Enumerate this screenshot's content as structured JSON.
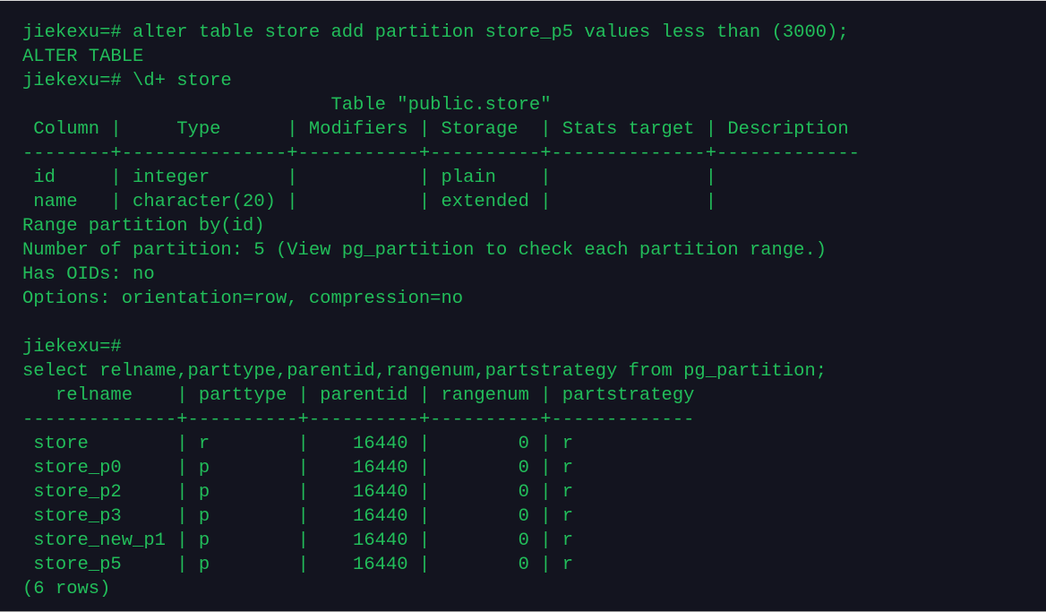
{
  "terminal": {
    "lines": [
      {
        "indent": 25,
        "text": "jiekexu=# alter table store add partition store_p5 values less than (3000);"
      },
      {
        "indent": 25,
        "text": "ALTER TABLE"
      },
      {
        "indent": 25,
        "text": "jiekexu=# \\d+ store"
      },
      {
        "indent": 25,
        "text": "                            Table \"public.store\""
      },
      {
        "indent": 25,
        "text": " Column |     Type      | Modifiers | Storage  | Stats target | Description"
      },
      {
        "indent": 25,
        "text": "--------+---------------+-----------+----------+--------------+-------------"
      },
      {
        "indent": 25,
        "text": " id     | integer       |           | plain    |              |"
      },
      {
        "indent": 25,
        "text": " name   | character(20) |           | extended |              |"
      },
      {
        "indent": 25,
        "text": "Range partition by(id)"
      },
      {
        "indent": 25,
        "text": "Number of partition: 5 (View pg_partition to check each partition range.)"
      },
      {
        "indent": 25,
        "text": "Has OIDs: no"
      },
      {
        "indent": 25,
        "text": "Options: orientation=row, compression=no"
      },
      {
        "indent": 25,
        "text": ""
      },
      {
        "indent": 25,
        "text": "jiekexu=#"
      },
      {
        "indent": 25,
        "text": "select relname,parttype,parentid,rangenum,partstrategy from pg_partition;"
      },
      {
        "indent": 25,
        "text": "   relname    | parttype | parentid | rangenum | partstrategy"
      },
      {
        "indent": 25,
        "text": "--------------+----------+----------+----------+-------------"
      },
      {
        "indent": 25,
        "text": " store        | r        |    16440 |        0 | r"
      },
      {
        "indent": 25,
        "text": " store_p0     | p        |    16440 |        0 | r"
      },
      {
        "indent": 25,
        "text": " store_p2     | p        |    16440 |        0 | r"
      },
      {
        "indent": 25,
        "text": " store_p3     | p        |    16440 |        0 | r"
      },
      {
        "indent": 25,
        "text": " store_new_p1 | p        |    16440 |        0 | r"
      },
      {
        "indent": 25,
        "text": " store_p5     | p        |    16440 |        0 | r"
      },
      {
        "indent": 25,
        "text": "(6 rows)"
      }
    ]
  }
}
